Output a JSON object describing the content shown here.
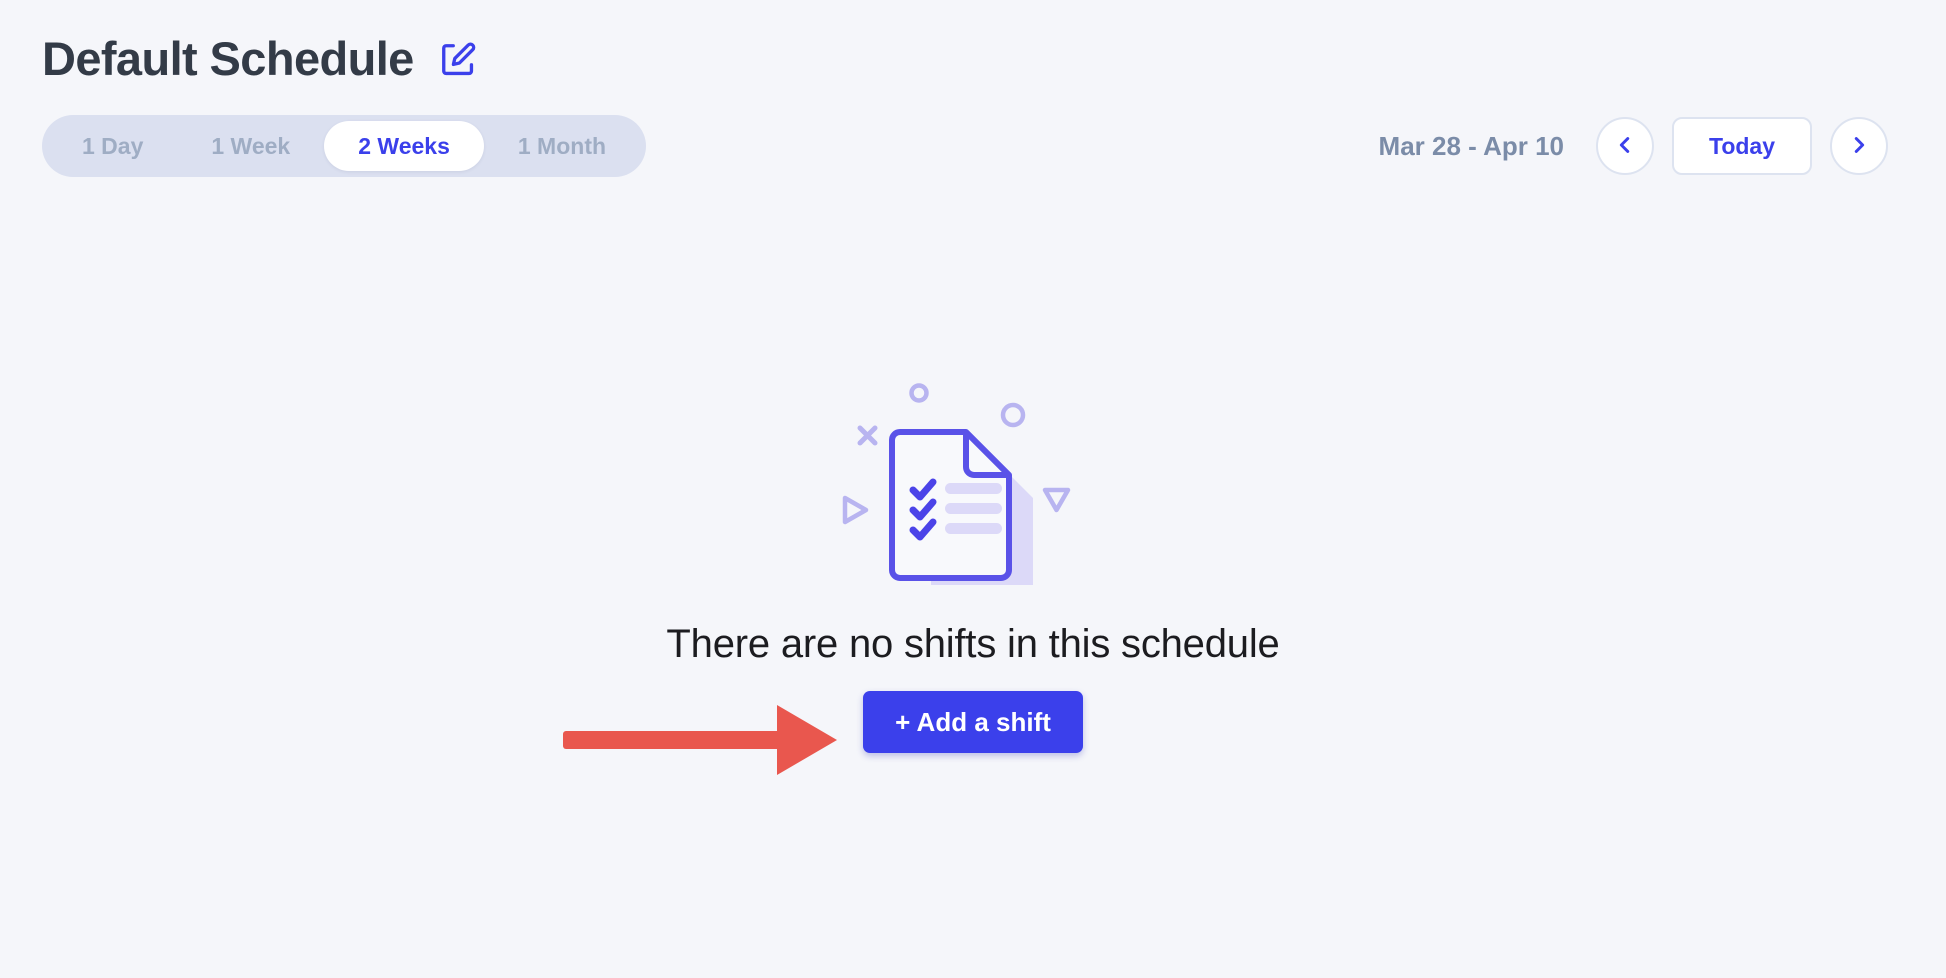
{
  "header": {
    "title": "Default Schedule",
    "edit_icon": "edit-pencil-icon"
  },
  "toolbar": {
    "range_tabs": [
      {
        "label": "1 Day",
        "active": false
      },
      {
        "label": "1 Week",
        "active": false
      },
      {
        "label": "2 Weeks",
        "active": true
      },
      {
        "label": "1 Month",
        "active": false
      }
    ],
    "date_range": "Mar 28 - Apr 10",
    "prev_icon": "chevron-left-icon",
    "next_icon": "chevron-right-icon",
    "today_label": "Today"
  },
  "empty_state": {
    "illustration": "document-checklist-icon",
    "message": "There are no shifts in this schedule",
    "add_shift_label": "+ Add a shift"
  },
  "annotation": {
    "arrow": "red-pointer-arrow"
  },
  "colors": {
    "page_background": "#f5f6fa",
    "title_text": "#333b47",
    "accent_blue": "#3b40eb",
    "tab_track": "#dbe0f0",
    "tab_inactive_text": "#9fadc4",
    "date_text": "#7b8ca8",
    "border": "#dde3f0",
    "illustration_light": "#dcd9f8",
    "annotation_red": "#e9574e"
  }
}
